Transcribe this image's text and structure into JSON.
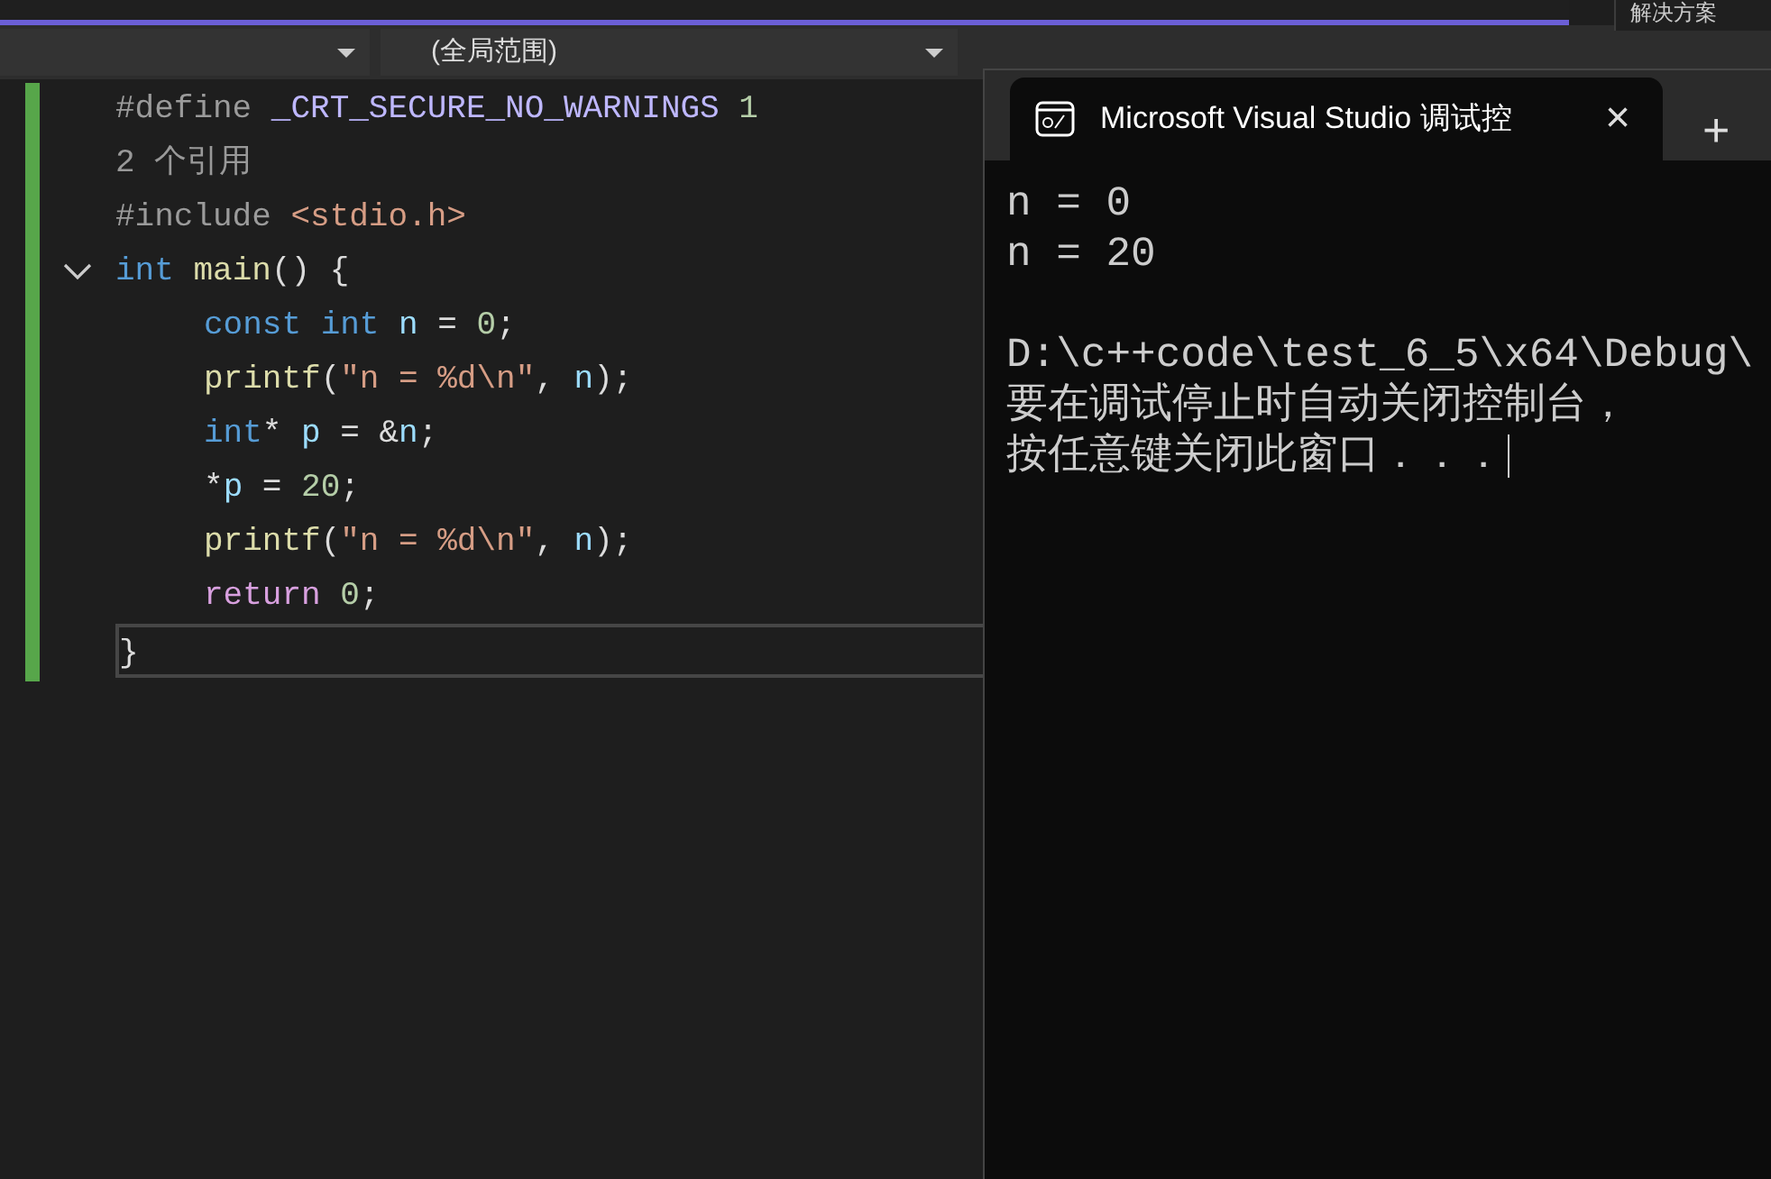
{
  "side_panel": {
    "title": "解决方案"
  },
  "navigation_bar": {
    "dropdowns": [
      {
        "kind": "dropdown"
      },
      {
        "kind": "dropdown",
        "label": "(全局范围)"
      }
    ]
  },
  "editor": {
    "lines": [
      {
        "tokens": [
          {
            "text": "#define ",
            "kind": "preproc"
          },
          {
            "text": "_CRT_SECURE_NO_WARNINGS",
            "kind": "macro"
          },
          {
            "text": " 1",
            "kind": "number"
          }
        ]
      },
      {
        "tokens": [
          {
            "text": "2 个引用",
            "kind": "hint"
          }
        ]
      },
      {
        "tokens": [
          {
            "text": "#include ",
            "kind": "preproc"
          },
          {
            "text": "<stdio.h>",
            "kind": "string"
          }
        ]
      },
      {
        "expanded": true,
        "tokens": [
          {
            "text": "int ",
            "kind": "keyword"
          },
          {
            "text": "main",
            "kind": "func"
          },
          {
            "text": "() {",
            "kind": "plain"
          }
        ],
        "children": [
          {
            "tokens": [
              {
                "text": "const ",
                "kind": "keyword"
              },
              {
                "text": "int ",
                "kind": "keyword"
              },
              {
                "text": "n",
                "kind": "ident"
              },
              {
                "text": " = ",
                "kind": "plain"
              },
              {
                "text": "0",
                "kind": "number"
              },
              {
                "text": ";",
                "kind": "plain"
              }
            ]
          },
          {
            "tokens": [
              {
                "text": "printf",
                "kind": "func"
              },
              {
                "text": "(",
                "kind": "plain"
              },
              {
                "text": "\"n = %d\\n\"",
                "kind": "string"
              },
              {
                "text": ", ",
                "kind": "plain"
              },
              {
                "text": "n",
                "kind": "ident"
              },
              {
                "text": ");",
                "kind": "plain"
              }
            ]
          },
          {
            "tokens": [
              {
                "text": "int",
                "kind": "keyword"
              },
              {
                "text": "* ",
                "kind": "plain"
              },
              {
                "text": "p",
                "kind": "ident"
              },
              {
                "text": " = &",
                "kind": "plain"
              },
              {
                "text": "n",
                "kind": "ident"
              },
              {
                "text": ";",
                "kind": "plain"
              }
            ]
          },
          {
            "tokens": [
              {
                "text": "*",
                "kind": "plain"
              },
              {
                "text": "p",
                "kind": "ident"
              },
              {
                "text": " = ",
                "kind": "plain"
              },
              {
                "text": "20",
                "kind": "number"
              },
              {
                "text": ";",
                "kind": "plain"
              }
            ]
          },
          {
            "tokens": [
              {
                "text": "printf",
                "kind": "func"
              },
              {
                "text": "(",
                "kind": "plain"
              },
              {
                "text": "\"n = %d\\n\"",
                "kind": "string"
              },
              {
                "text": ", ",
                "kind": "plain"
              },
              {
                "text": "n",
                "kind": "ident"
              },
              {
                "text": ");",
                "kind": "plain"
              }
            ]
          },
          {
            "tokens": [
              {
                "text": "return ",
                "kind": "control"
              },
              {
                "text": "0",
                "kind": "number"
              },
              {
                "text": ";",
                "kind": "plain"
              }
            ]
          }
        ]
      },
      {
        "current": true,
        "tokens": [
          {
            "text": "}",
            "kind": "plain"
          }
        ]
      }
    ]
  },
  "console": {
    "tab": {
      "title": "Microsoft Visual Studio 调试控",
      "close": "×"
    },
    "new_tab": "+",
    "blocks": [
      [
        "n = 0",
        "n = 20"
      ],
      [
        "D:\\c++code\\test_6_5\\x64\\Debug\\",
        "要在调试停止时自动关闭控制台，",
        "按任意键关闭此窗口．．．"
      ]
    ]
  }
}
